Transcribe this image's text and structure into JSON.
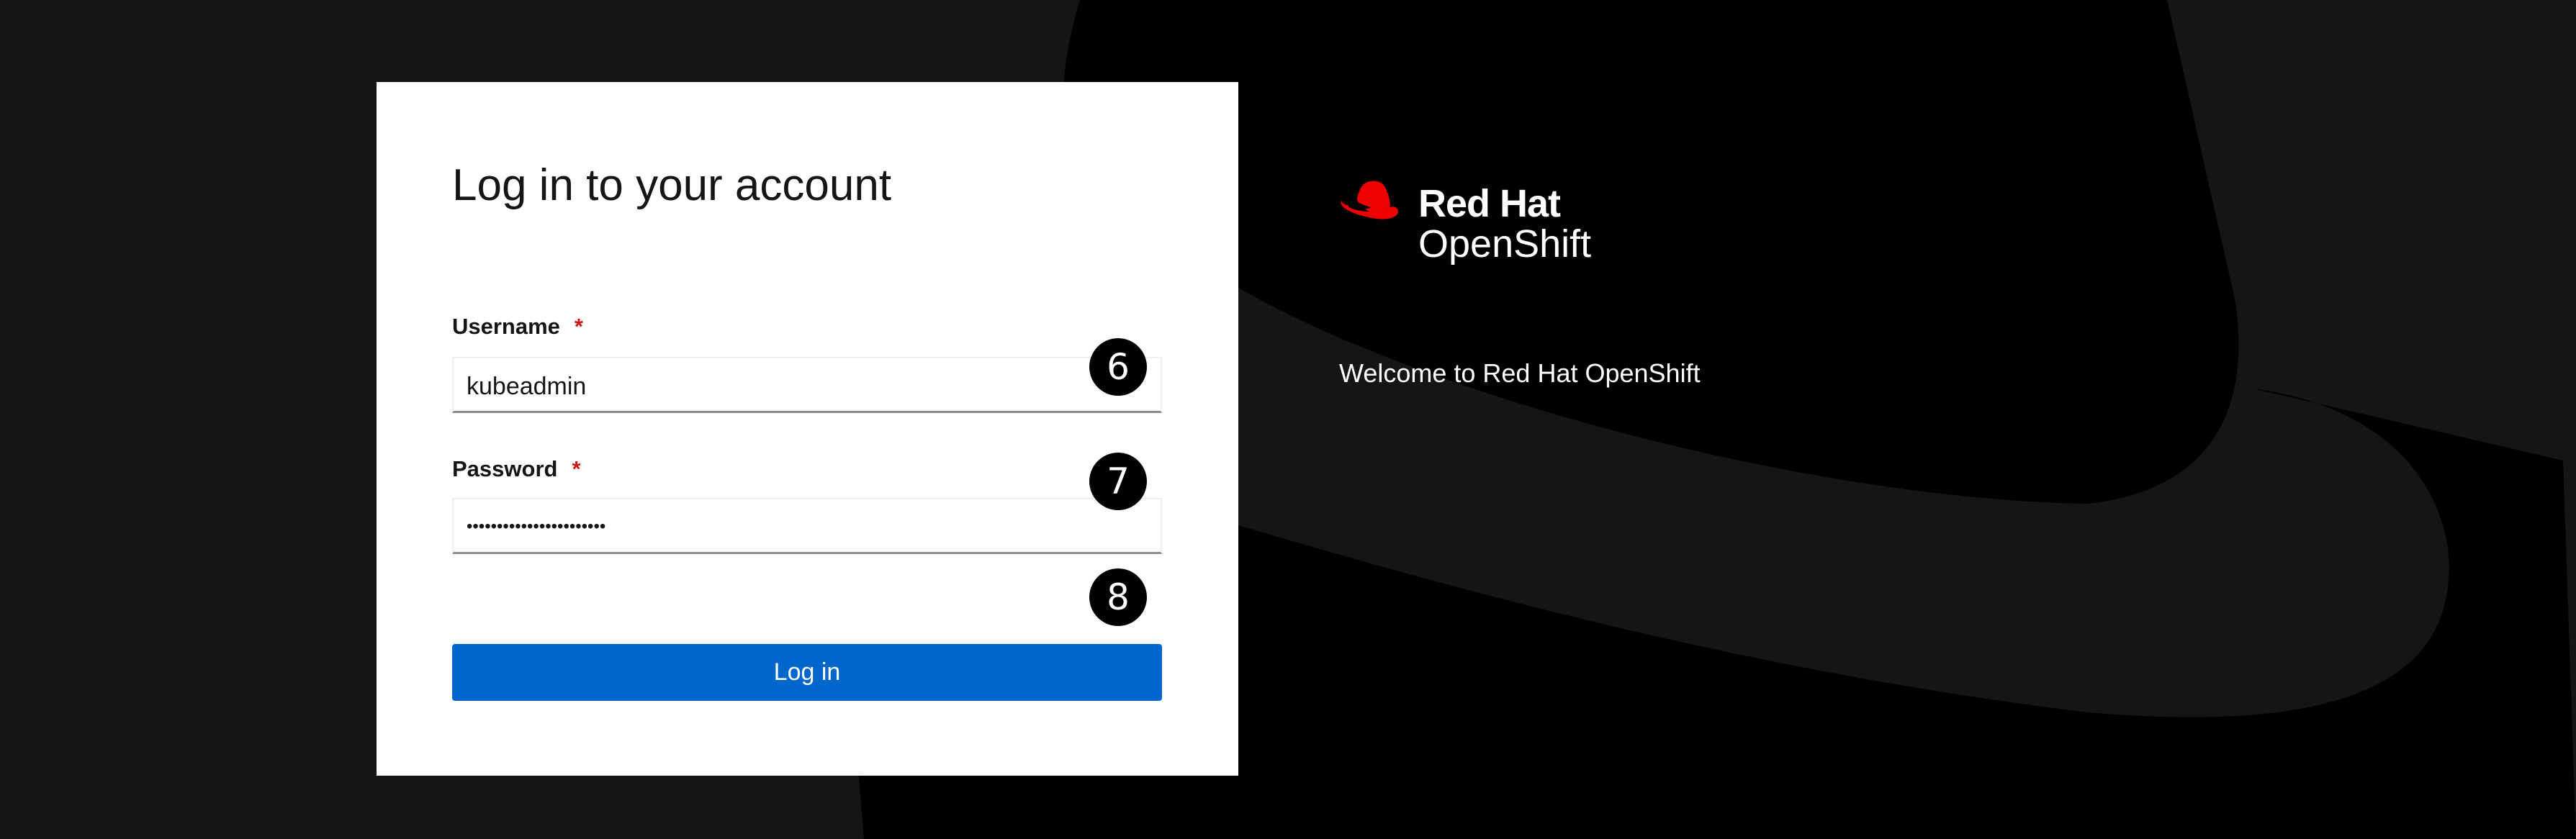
{
  "login": {
    "title": "Log in to your account",
    "username_label": "Username",
    "username_required": "*",
    "username_value": "kubeadmin",
    "password_label": "Password",
    "password_required": "*",
    "password_value": "•••••••••••••••••••••••",
    "submit_label": "Log in"
  },
  "annotations": {
    "badge_6": "6",
    "badge_7": "7",
    "badge_8": "8"
  },
  "brand": {
    "line1": "Red Hat",
    "line2": "OpenShift",
    "logo_icon": "redhat-fedora-icon",
    "logo_color": "#ee0000",
    "welcome": "Welcome to Red Hat OpenShift"
  },
  "colors": {
    "background": "#151515",
    "hat": "#000000",
    "primary_button": "#0066cc",
    "required": "#c9190b"
  }
}
